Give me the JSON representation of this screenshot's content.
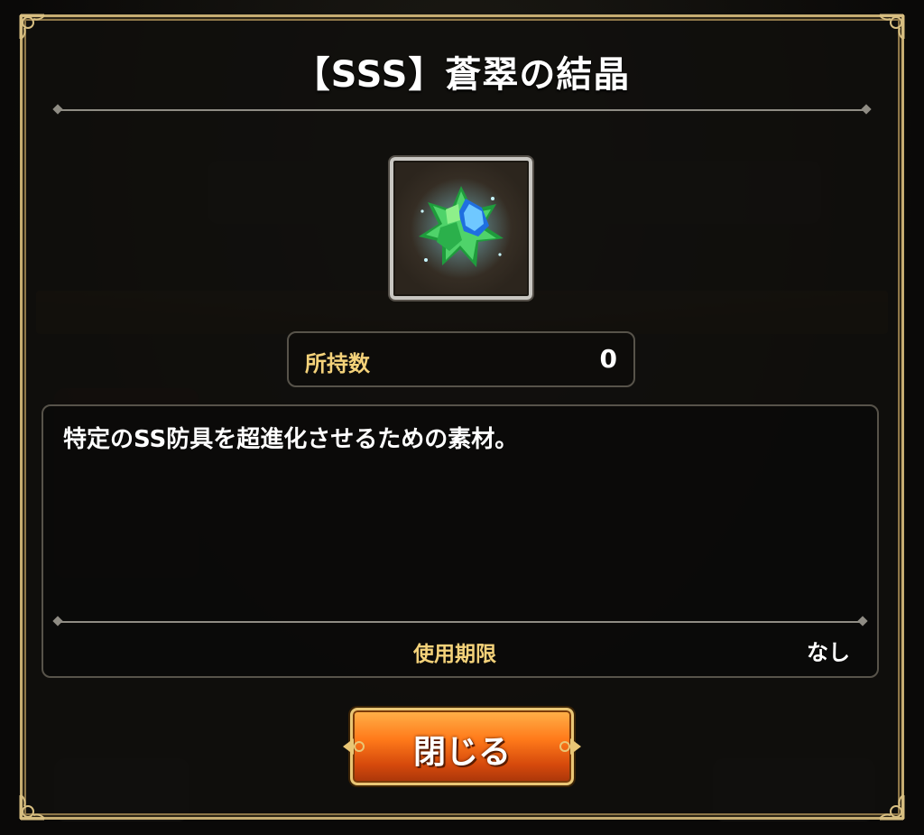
{
  "dialog": {
    "title": "【SSS】蒼翠の結晶",
    "item": {
      "icon": "green-blue-crystal-icon"
    },
    "owned": {
      "label": "所持数",
      "value": "0"
    },
    "description": "特定のSS防具を超進化させるための素材。",
    "expiry": {
      "label": "使用期限",
      "value": "なし"
    },
    "close_button": {
      "label": "閉じる"
    }
  },
  "colors": {
    "frame_gold": "#c6ad72",
    "label_gold": "#f4d27a",
    "button_orange": "#ff7a1a"
  }
}
